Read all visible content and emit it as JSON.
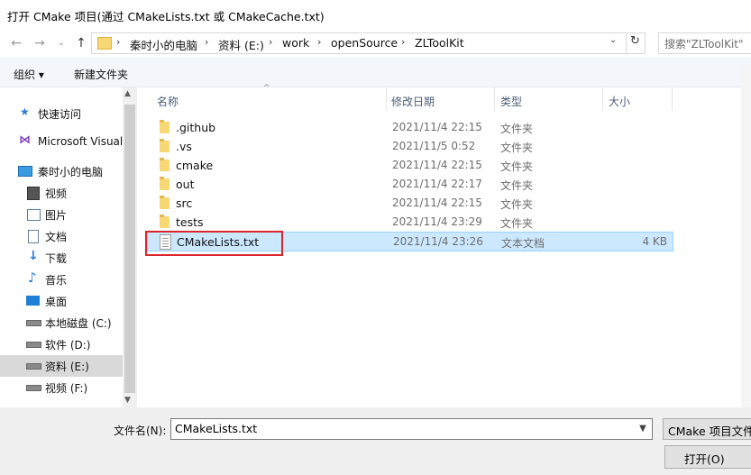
{
  "window": {
    "title": "打开 CMake 项目(通过 CMakeLists.txt 或 CMakeCache.txt)"
  },
  "nav": {
    "back": "←",
    "forward": "→",
    "recent": "⌄",
    "up": "↑",
    "refresh": "↻",
    "addr_dropdown": "⌄"
  },
  "breadcrumb": [
    "秦时小的电脑",
    "资料 (E:)",
    "work",
    "openSource",
    "ZLToolKit"
  ],
  "search": {
    "placeholder": "搜索\"ZLToolKit\""
  },
  "toolbar": {
    "organize": "组织 ▾",
    "new_folder": "新建文件夹"
  },
  "sidebar": {
    "items": [
      {
        "label": "快速访问",
        "icon": "star-icon"
      },
      {
        "label": "Microsoft Visual",
        "icon": "visual-studio-icon"
      },
      {
        "label": "秦时小的电脑",
        "icon": "computer-icon"
      },
      {
        "label": "视频",
        "icon": "video-icon"
      },
      {
        "label": "图片",
        "icon": "picture-icon"
      },
      {
        "label": "文档",
        "icon": "document-icon"
      },
      {
        "label": "下载",
        "icon": "download-icon"
      },
      {
        "label": "音乐",
        "icon": "music-icon"
      },
      {
        "label": "桌面",
        "icon": "desktop-icon"
      },
      {
        "label": "本地磁盘 (C:)",
        "icon": "drive-icon"
      },
      {
        "label": "软件 (D:)",
        "icon": "drive-icon"
      },
      {
        "label": "资料 (E:)",
        "icon": "drive-icon",
        "selected": true
      },
      {
        "label": "视频 (F:)",
        "icon": "drive-icon"
      }
    ]
  },
  "columns": {
    "name": "名称",
    "date": "修改日期",
    "type": "类型",
    "size": "大小"
  },
  "files": [
    {
      "name": ".github",
      "date": "2021/11/4 22:15",
      "type": "文件夹",
      "size": "",
      "kind": "folder"
    },
    {
      "name": ".vs",
      "date": "2021/11/5 0:52",
      "type": "文件夹",
      "size": "",
      "kind": "folder"
    },
    {
      "name": "cmake",
      "date": "2021/11/4 22:15",
      "type": "文件夹",
      "size": "",
      "kind": "folder"
    },
    {
      "name": "out",
      "date": "2021/11/4 22:17",
      "type": "文件夹",
      "size": "",
      "kind": "folder"
    },
    {
      "name": "src",
      "date": "2021/11/4 22:15",
      "type": "文件夹",
      "size": "",
      "kind": "folder"
    },
    {
      "name": "tests",
      "date": "2021/11/4 23:29",
      "type": "文件夹",
      "size": "",
      "kind": "folder"
    },
    {
      "name": "CMakeLists.txt",
      "date": "2021/11/4 23:26",
      "type": "文本文档",
      "size": "4 KB",
      "kind": "text",
      "selected": true
    }
  ],
  "footer": {
    "filename_label": "文件名(N):",
    "filename_value": "CMakeLists.txt",
    "filter_value": "CMake 项目文件",
    "open_button": "打开(O)"
  },
  "colors": {
    "selection": "#cce8ff",
    "highlight_box": "#d9262c",
    "toolbar_bg": "#f3f6fb"
  }
}
